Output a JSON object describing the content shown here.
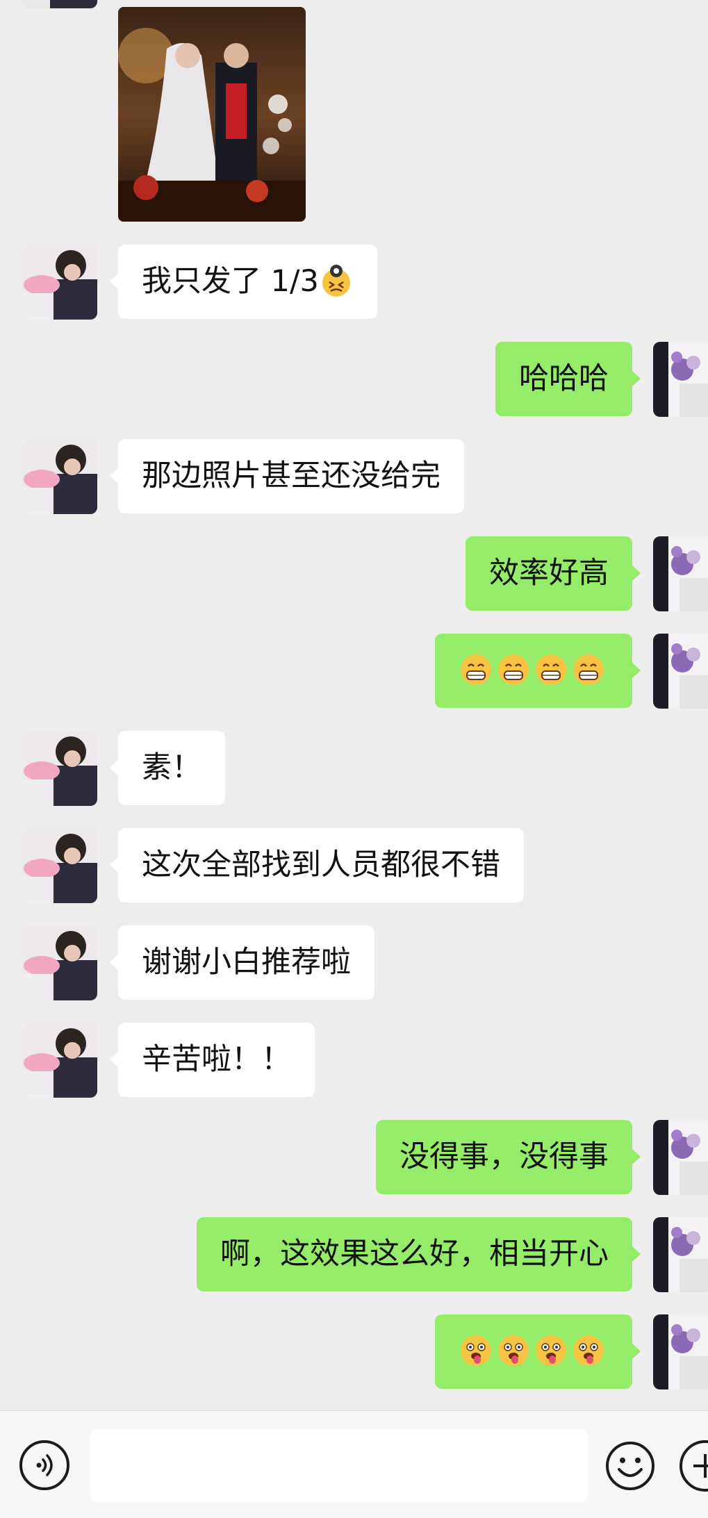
{
  "messages": [
    {
      "side": "in",
      "text": "我只发了 1/3",
      "emoji": "dizzy-face"
    },
    {
      "side": "out",
      "text": "哈哈哈"
    },
    {
      "side": "in",
      "text": "那边照片甚至还没给完"
    },
    {
      "side": "out",
      "text": "效率好高"
    },
    {
      "side": "out",
      "text": "",
      "emoji_row": [
        "grin",
        "grin",
        "grin",
        "grin"
      ]
    },
    {
      "side": "in",
      "text": "素！"
    },
    {
      "side": "in",
      "text": "这次全部找到人员都很不错"
    },
    {
      "side": "in",
      "text": "谢谢小白推荐啦"
    },
    {
      "side": "in",
      "text": "辛苦啦！！"
    },
    {
      "side": "out",
      "text": "没得事，没得事"
    },
    {
      "side": "out",
      "text": "啊，这效果这么好，相当开心"
    },
    {
      "side": "out",
      "text": "",
      "emoji_row": [
        "tongue-out",
        "tongue-out",
        "tongue-out",
        "tongue-out"
      ]
    }
  ],
  "colors": {
    "background": "#ededed",
    "incoming_bubble": "#ffffff",
    "outgoing_bubble": "#95ec69"
  },
  "input_bar": {
    "voice_icon": "voice-icon",
    "emoji_icon": "smiley-icon",
    "more_icon": "plus-icon",
    "input_value": ""
  }
}
